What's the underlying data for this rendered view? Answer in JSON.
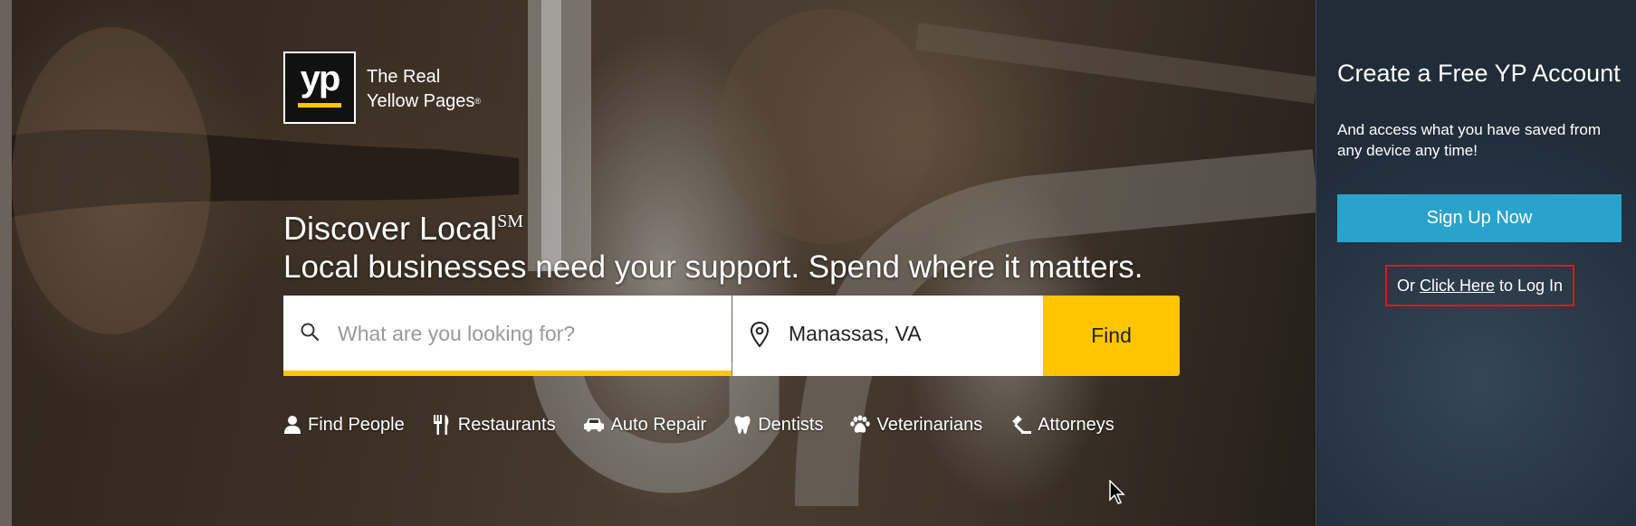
{
  "brand": {
    "logo_text": "yp",
    "tagline_line1": "The Real",
    "tagline_line2": "Yellow Pages",
    "tagline_mark": "®",
    "accent_color": "#ffc600"
  },
  "hero": {
    "headline": "Discover Local",
    "headline_mark": "SM",
    "subheadline": "Local businesses need your support. Spend where it matters."
  },
  "search": {
    "what_placeholder": "What are you looking for?",
    "what_icon": "search-icon",
    "where_value": "Manassas, VA",
    "where_icon": "map-pin-icon",
    "find_label": "Find"
  },
  "quick_links": [
    {
      "label": "Find People",
      "icon": "person-icon"
    },
    {
      "label": "Restaurants",
      "icon": "fork-knife-icon"
    },
    {
      "label": "Auto Repair",
      "icon": "car-icon"
    },
    {
      "label": "Dentists",
      "icon": "tooth-icon"
    },
    {
      "label": "Veterinarians",
      "icon": "paw-icon"
    },
    {
      "label": "Attorneys",
      "icon": "gavel-icon"
    }
  ],
  "account_panel": {
    "title": "Create a Free YP Account",
    "subtitle": "And access what you have saved from any device any time!",
    "signup_label": "Sign Up Now",
    "signup_color": "#2aa3cc",
    "login_prefix": "Or",
    "login_link": "Click Here",
    "login_suffix": "to Log In",
    "highlight_color": "#e0161b"
  }
}
